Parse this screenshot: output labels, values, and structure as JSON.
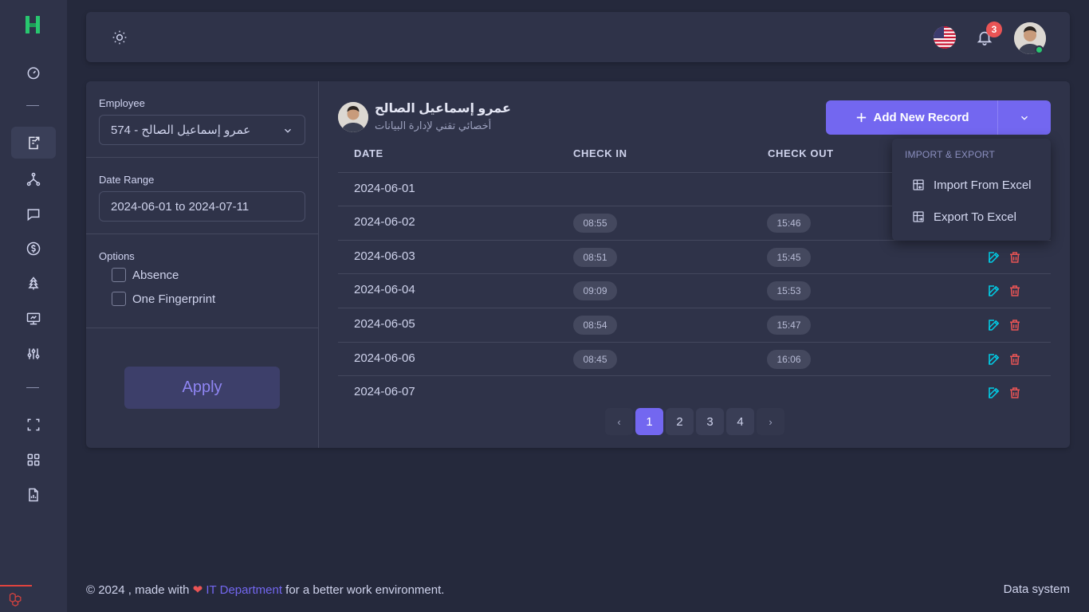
{
  "sidebar": {
    "icons": [
      "dashboard-icon",
      "attendance-icon",
      "hierarchy-icon",
      "chat-icon",
      "dollar-icon",
      "tree-icon",
      "presentation-icon",
      "sliders-icon",
      "scan-icon",
      "apps-icon",
      "report-icon"
    ],
    "active": "attendance-icon"
  },
  "navbar": {
    "notification_count": "3"
  },
  "filters": {
    "employee_label": "Employee",
    "employee_value": "574 - عمرو إسماعيل الصالح",
    "date_range_label": "Date Range",
    "date_range_value": "2024-06-01 to 2024-07-11",
    "options_label": "Options",
    "option_absence": "Absence",
    "option_one_fingerprint": "One Fingerprint",
    "apply_label": "Apply"
  },
  "employee": {
    "name": "عمرو إسماعيل الصالح",
    "title": "أخصائي تقني لإدارة البيانات"
  },
  "actions": {
    "add_label": "Add New Record"
  },
  "menu": {
    "header": "IMPORT & EXPORT",
    "import_label": "Import From Excel",
    "export_label": "Export To Excel"
  },
  "table": {
    "headers": [
      "DATE",
      "CHECK IN",
      "CHECK OUT"
    ],
    "rows": [
      {
        "date": "2024-06-01",
        "check_in": "",
        "check_out": ""
      },
      {
        "date": "2024-06-02",
        "check_in": "08:55",
        "check_out": "15:46"
      },
      {
        "date": "2024-06-03",
        "check_in": "08:51",
        "check_out": "15:45"
      },
      {
        "date": "2024-06-04",
        "check_in": "09:09",
        "check_out": "15:53"
      },
      {
        "date": "2024-06-05",
        "check_in": "08:54",
        "check_out": "15:47"
      },
      {
        "date": "2024-06-06",
        "check_in": "08:45",
        "check_out": "16:06"
      },
      {
        "date": "2024-06-07",
        "check_in": "",
        "check_out": ""
      }
    ]
  },
  "pagination": {
    "prev": "‹",
    "pages": [
      "1",
      "2",
      "3",
      "4"
    ],
    "active": "1",
    "next": "›"
  },
  "footer": {
    "prefix": "© 2024 , made with",
    "heart": "❤",
    "link": "IT Department",
    "suffix": "for a better work environment.",
    "right": "Data system"
  },
  "colors": {
    "accent": "#7367f0",
    "background": "#25293c",
    "card": "#2f3349",
    "edit": "#00cfe8",
    "delete": "#ea5455",
    "badge": "#ea5455",
    "online": "#28c76f"
  }
}
